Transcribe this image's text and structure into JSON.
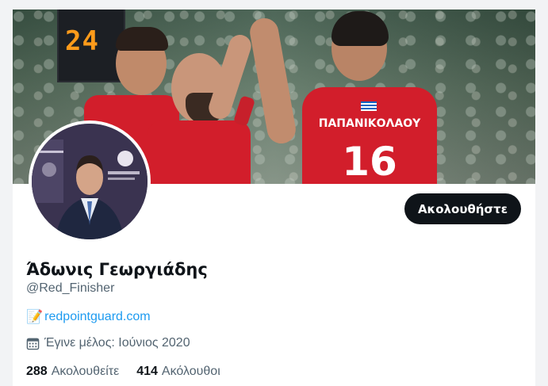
{
  "banner": {
    "scoreboard": "24",
    "jersey_name": "ΠΑΠΑΝΙΚΟΛΑΟΥ",
    "jersey_number": "16"
  },
  "profile": {
    "name": "Άδωνις Γεωργιάδης",
    "handle": "@Red_Finisher",
    "link_emoji": "📝",
    "link_text": "redpointguard.com",
    "joined": "Έγινε μέλος: Ιούνιος 2020",
    "follow_label": "Ακολουθήστε"
  },
  "stats": {
    "following_count": "288",
    "following_label": "Ακολουθείτε",
    "followers_count": "414",
    "followers_label": "Ακόλουθοι"
  },
  "colors": {
    "accent": "#1d9bf0",
    "button": "#0f1419",
    "secondary_text": "#536471",
    "jersey_red": "#d21e2b"
  }
}
